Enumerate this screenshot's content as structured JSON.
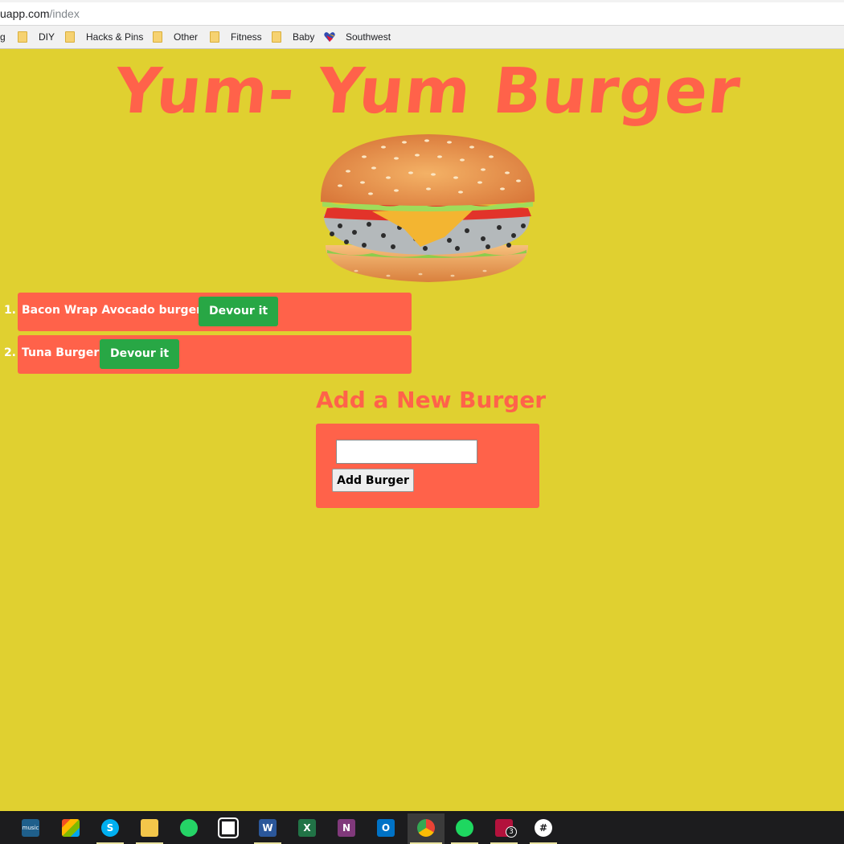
{
  "browser": {
    "url_host": "uapp.com",
    "url_path": "/index",
    "bookmarks": [
      {
        "label": "g"
      },
      {
        "label": "DIY"
      },
      {
        "label": "Hacks & Pins"
      },
      {
        "label": "Other"
      },
      {
        "label": "Fitness"
      },
      {
        "label": "Baby"
      },
      {
        "label": "Southwest"
      }
    ]
  },
  "page": {
    "title": "Yum- Yum Burger",
    "burgers": [
      {
        "number": "1.",
        "name": "Bacon Wrap Avocado burger",
        "button_label": "Devour it"
      },
      {
        "number": "2.",
        "name": "Tuna Burger",
        "button_label": "Devour it"
      }
    ],
    "add_heading": "Add a New Burger",
    "input_value": "",
    "add_button_label": "Add Burger"
  },
  "taskbar": {
    "apps": [
      {
        "icon": "amazon-music-icon",
        "label": "music"
      },
      {
        "icon": "photos-icon",
        "label": ""
      },
      {
        "icon": "skype-icon",
        "label": "S"
      },
      {
        "icon": "file-explorer-icon",
        "label": ""
      },
      {
        "icon": "whatsapp-icon",
        "label": ""
      },
      {
        "icon": "calendar-icon",
        "label": ""
      },
      {
        "icon": "word-icon",
        "label": "W"
      },
      {
        "icon": "excel-icon",
        "label": "X"
      },
      {
        "icon": "onenote-icon",
        "label": "N"
      },
      {
        "icon": "outlook-icon",
        "label": "O"
      },
      {
        "icon": "chrome-icon",
        "label": ""
      },
      {
        "icon": "spotify-icon",
        "label": ""
      },
      {
        "icon": "app-badge-icon",
        "label": "3"
      },
      {
        "icon": "slack-icon",
        "label": "#"
      }
    ]
  },
  "colors": {
    "background": "#e0d030",
    "accent": "#ff624a",
    "button_green": "#28a745"
  }
}
